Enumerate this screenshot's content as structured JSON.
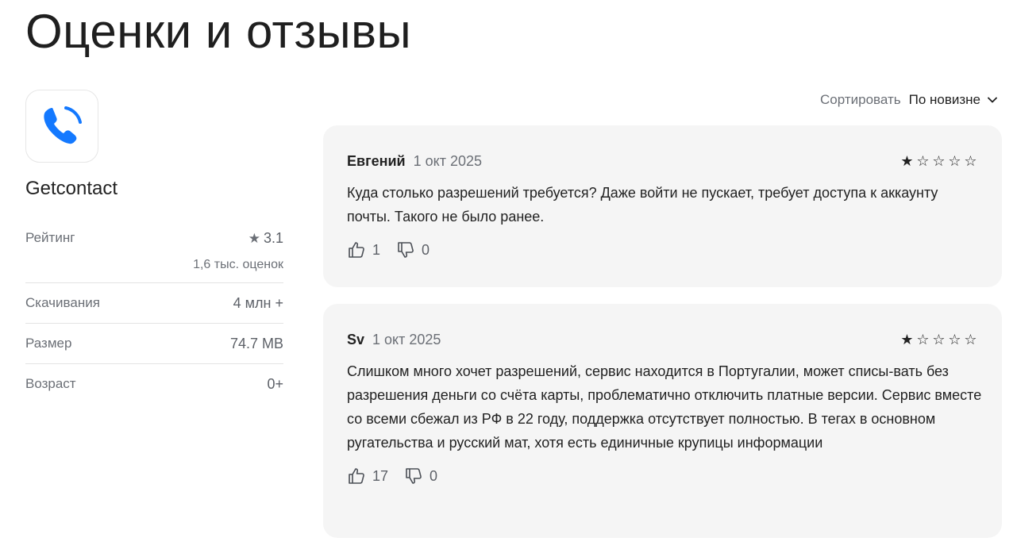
{
  "page": {
    "title": "Оценки и отзывы"
  },
  "app": {
    "name": "Getcontact",
    "icon": "phone-call-icon",
    "accent_color": "#1479FF"
  },
  "info": {
    "rating_label": "Рейтинг",
    "rating_value": "3.1",
    "rating_count": "1,6 тыс. оценок",
    "downloads_label": "Скачивания",
    "downloads_value": "4 млн +",
    "size_label": "Размер",
    "size_value": "74.7 MB",
    "age_label": "Возраст",
    "age_value": "0+"
  },
  "sort": {
    "label": "Сортировать",
    "value": "По новизне"
  },
  "reviews": [
    {
      "author": "Евгений",
      "date": "1 окт 2025",
      "rating": 1,
      "text": "Куда столько разрешений требуется? Даже войти не пускает, требует доступа к аккаунту почты. Такого не было ранее.",
      "likes": "1",
      "dislikes": "0"
    },
    {
      "author": "Sv",
      "date": "1 окт 2025",
      "rating": 1,
      "text": "Слишком много хочет разрешений, сервис находится в Португалии, может списы-вать без разрешения деньги со счёта карты, проблематично отключить платные версии. Сервис вместе со всеми сбежал из РФ в 22 году, поддержка отсутствует полностью. В тегах в основном ругательства и русский мат, хотя есть единичные крупицы информации",
      "likes": "17",
      "dislikes": "0"
    }
  ]
}
